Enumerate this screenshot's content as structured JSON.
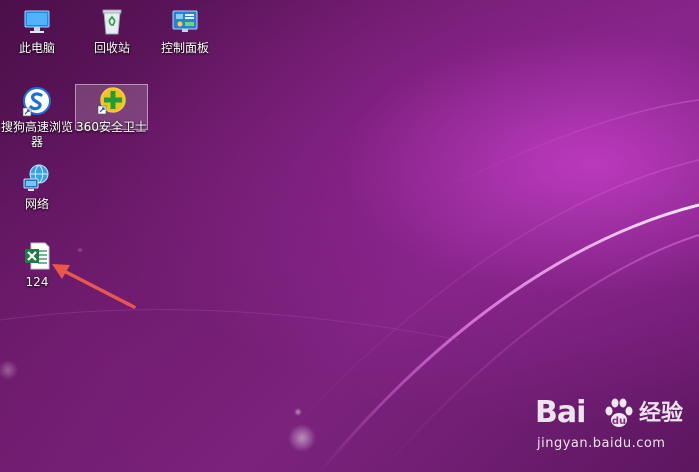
{
  "desktop": {
    "icons": [
      {
        "label": "此电脑",
        "icon": "this-pc-icon"
      },
      {
        "label": "回收站",
        "icon": "recycle-bin-icon"
      },
      {
        "label": "控制面板",
        "icon": "control-panel-icon"
      },
      {
        "label": "搜狗高速浏览器",
        "icon": "sogou-browser-icon"
      },
      {
        "label": "360安全卫士",
        "icon": "360-security-icon",
        "selected": true
      },
      {
        "label": "网络",
        "icon": "network-icon"
      },
      {
        "label": "124",
        "icon": "excel-file-icon"
      }
    ]
  },
  "annotation": {
    "arrow_color": "#e8574c",
    "points_to": "124"
  },
  "watermark": {
    "logo": "Bai",
    "logo_suffix": "经验",
    "url": "jingyan.baidu.com"
  },
  "colors": {
    "wallpaper_base": "#5a1557",
    "wallpaper_highlight": "#d042d2",
    "selection": "#ffffff"
  }
}
